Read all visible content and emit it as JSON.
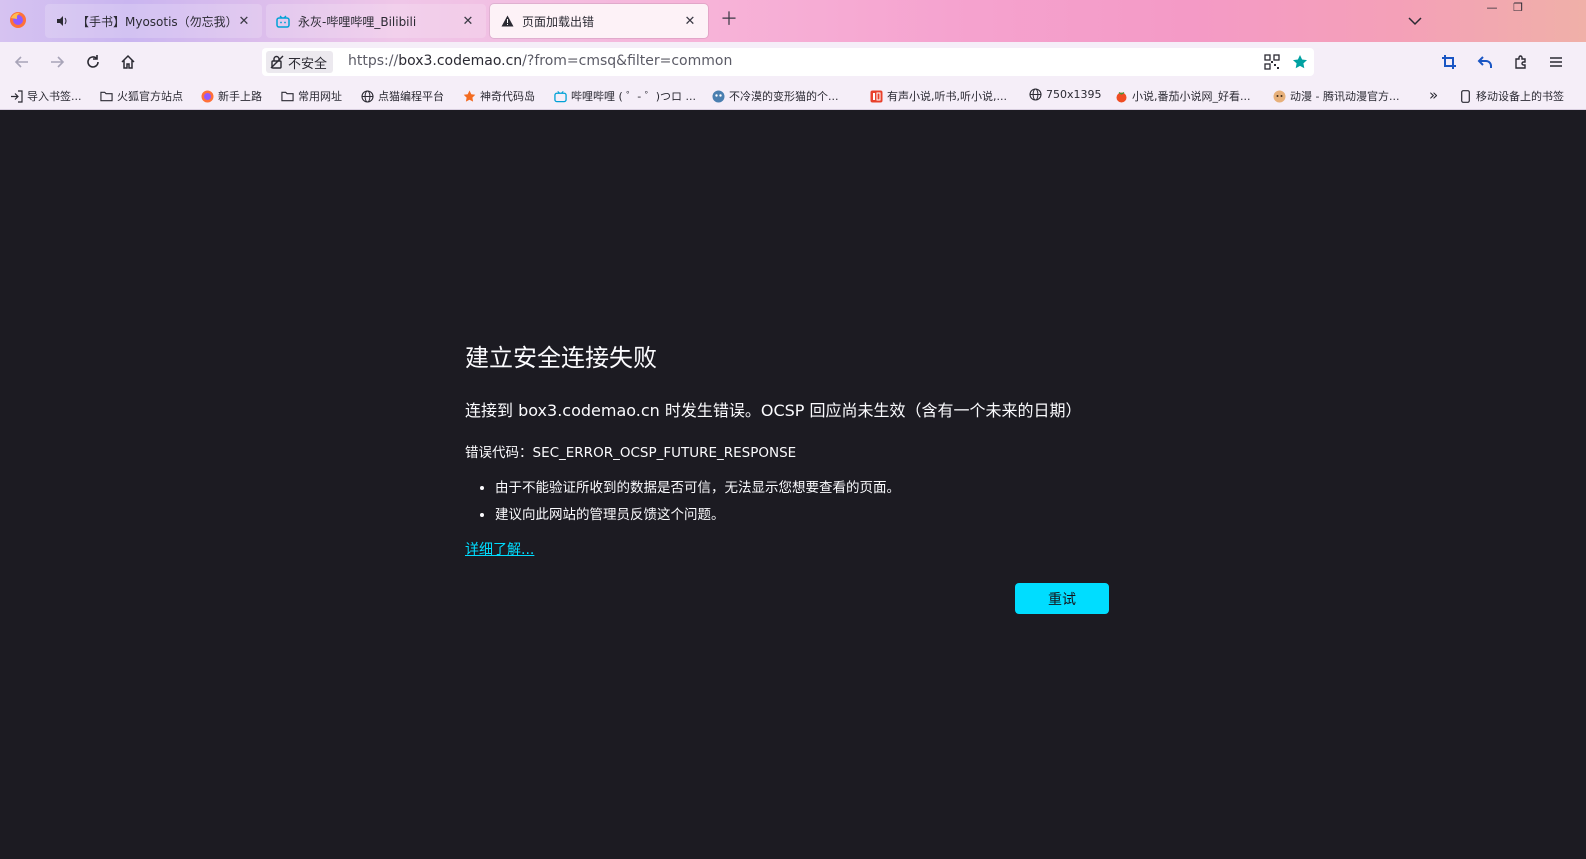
{
  "tabs": [
    {
      "label": "【手书】Myosotis（勿忘我）",
      "icon": "speaker-icon",
      "active": false
    },
    {
      "label": "永灰-哔哩哔哩_Bilibili",
      "icon": "bilibili-icon",
      "active": false
    },
    {
      "label": "页面加载出错",
      "icon": "warning-icon",
      "active": true
    }
  ],
  "urlbar": {
    "security_label": "不安全",
    "url_prefix": "https://",
    "url_host": "box3.codemao.cn",
    "url_rest": "/?from=cmsq&filter=common"
  },
  "bookmarks": [
    {
      "label": "导入书签...",
      "icon": "import-icon"
    },
    {
      "label": "火狐官方站点",
      "icon": "folder-icon"
    },
    {
      "label": "新手上路",
      "icon": "firefox-icon"
    },
    {
      "label": "常用网址",
      "icon": "folder-icon"
    },
    {
      "label": "点猫编程平台",
      "icon": "globe-icon"
    },
    {
      "label": "神奇代码岛",
      "icon": "code-island-icon"
    },
    {
      "label": "哔哩哔哩 ( ゜- ゜)つロ ...",
      "icon": "bilibili-icon"
    },
    {
      "label": "不冷漠的变形猫的个...",
      "icon": "avatar-icon"
    },
    {
      "label": "有声小说,听书,听小说,...",
      "icon": "audio-book-icon"
    },
    {
      "label": "750x1395",
      "icon": "globe-icon"
    },
    {
      "label": "小说,番茄小说网_好看...",
      "icon": "tomato-icon"
    },
    {
      "label": "动漫 - 腾讯动漫官方...",
      "icon": "anime-icon"
    }
  ],
  "mobile_bookmarks": "移动设备上的书签",
  "error": {
    "title": "建立安全连接失败",
    "description": "连接到 box3.codemao.cn 时发生错误。OCSP 回应尚未生效（含有一个未来的日期）",
    "code": "错误代码：SEC_ERROR_OCSP_FUTURE_RESPONSE",
    "bullets": [
      "由于不能验证所收到的数据是否可信，无法显示您想要查看的页面。",
      "建议向此网站的管理员反馈这个问题。"
    ],
    "learn_more": "详细了解...",
    "retry": "重试"
  },
  "colors": {
    "accent": "#00ddff",
    "page_bg": "#1c1b22",
    "bookmark_star": "#00a1a1"
  }
}
